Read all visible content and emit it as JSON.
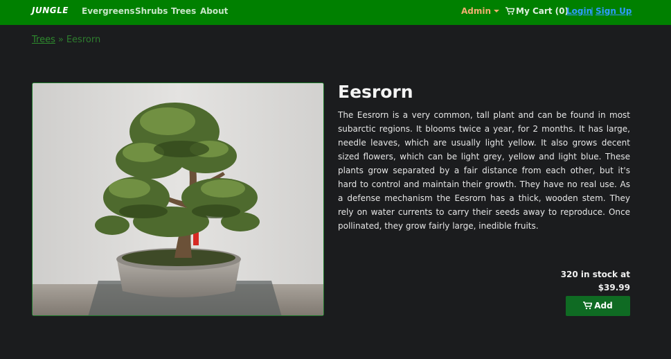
{
  "navbar": {
    "brand": "JUNGLE",
    "links": [
      "Evergreens",
      "Shrubs",
      "Trees",
      "About"
    ],
    "admin_label": "Admin",
    "cart_label": "My Cart (0)",
    "login_label": "Login",
    "separator": "|",
    "signup_label": "Sign Up",
    "bg_color": "#008000"
  },
  "breadcrumb": {
    "parent": "Trees",
    "separator": "»",
    "current": "Eesrorn"
  },
  "product": {
    "image_icon": "bonsai-tree-photo",
    "name": "Eesrorn",
    "description": "The Eesrorn is a very common, tall plant and can be found in most subarctic regions. It blooms twice a year, for 2 months. It has large, needle leaves, which are usually light yellow. It also grows decent sized flowers, which can be light grey, yellow and light blue. These plants grow separated by a fair distance from each other, but it's hard to control and maintain their growth. They have no real use. As a defense mechanism the Eesrorn has a thick, wooden stem. They rely on water currents to carry their seeds away to reproduce. Once pollinated, they grow fairly large, inedible fruits.",
    "stock_text": "320 in stock at",
    "price": "$39.99",
    "add_label": "Add",
    "add_icon": "cart-icon"
  }
}
